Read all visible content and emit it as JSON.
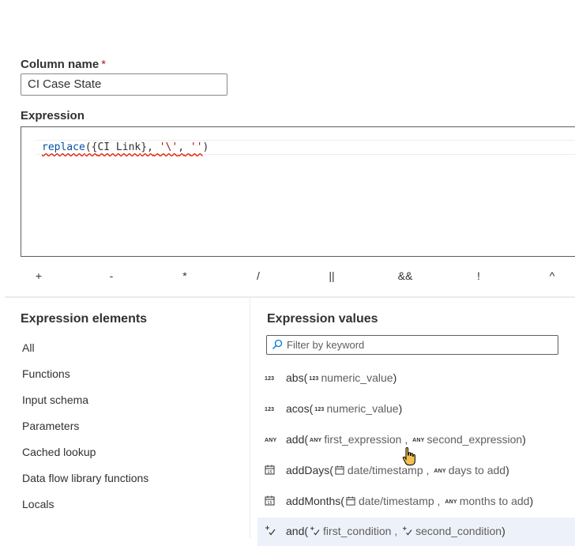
{
  "column_name": {
    "label": "Column name",
    "required_mark": "*",
    "value": "CI Case State"
  },
  "expression": {
    "label": "Expression",
    "code_tokens": {
      "fn": "replace",
      "open": "({",
      "field": "CI Link",
      "close": "},",
      "sp1": " ",
      "arg1": "'\\'",
      "comma": ",",
      "sp2": " ",
      "arg2": "''",
      "end": ")"
    }
  },
  "operators": [
    "+",
    "-",
    "*",
    "/",
    "||",
    "&&",
    "!",
    "^"
  ],
  "expression_elements": {
    "title": "Expression elements",
    "items": [
      "All",
      "Functions",
      "Input schema",
      "Parameters",
      "Cached lookup",
      "Data flow library functions",
      "Locals"
    ]
  },
  "expression_values": {
    "title": "Expression values",
    "filter_placeholder": "Filter by keyword",
    "functions": [
      {
        "type_icon": "numeric-type-icon",
        "type_label": "123",
        "name": "abs(",
        "params": [
          {
            "type": "123",
            "name": "numeric_value"
          }
        ],
        "end": ")"
      },
      {
        "type_icon": "numeric-type-icon",
        "type_label": "123",
        "name": "acos(",
        "params": [
          {
            "type": "123",
            "name": "numeric_value"
          }
        ],
        "end": ")"
      },
      {
        "type_icon": "any-type-icon",
        "type_label": "ANY",
        "name": "add(",
        "params": [
          {
            "type": "ANY",
            "name": "first_expression"
          },
          {
            "type": "ANY",
            "name": "second_expression"
          }
        ],
        "end": ")"
      },
      {
        "type_icon": "calendar-icon",
        "type_label": "",
        "name": "addDays(",
        "params": [
          {
            "type": "calendar",
            "name": "date/timestamp"
          },
          {
            "type": "ANY",
            "name": "days to add"
          }
        ],
        "end": ")"
      },
      {
        "type_icon": "calendar-icon",
        "type_label": "",
        "name": "addMonths(",
        "params": [
          {
            "type": "calendar",
            "name": "date/timestamp"
          },
          {
            "type": "ANY",
            "name": "months to add"
          }
        ],
        "end": ")"
      },
      {
        "type_icon": "boolean-icon",
        "type_label": "",
        "name": "and(",
        "params": [
          {
            "type": "boolean",
            "name": "first_condition"
          },
          {
            "type": "boolean",
            "name": "second_condition"
          }
        ],
        "end": ")"
      }
    ]
  },
  "colors": {
    "accent": "#0078d4",
    "required": "#a4262c",
    "selected_row": "#edf2fa",
    "squiggle": "#e51400"
  }
}
